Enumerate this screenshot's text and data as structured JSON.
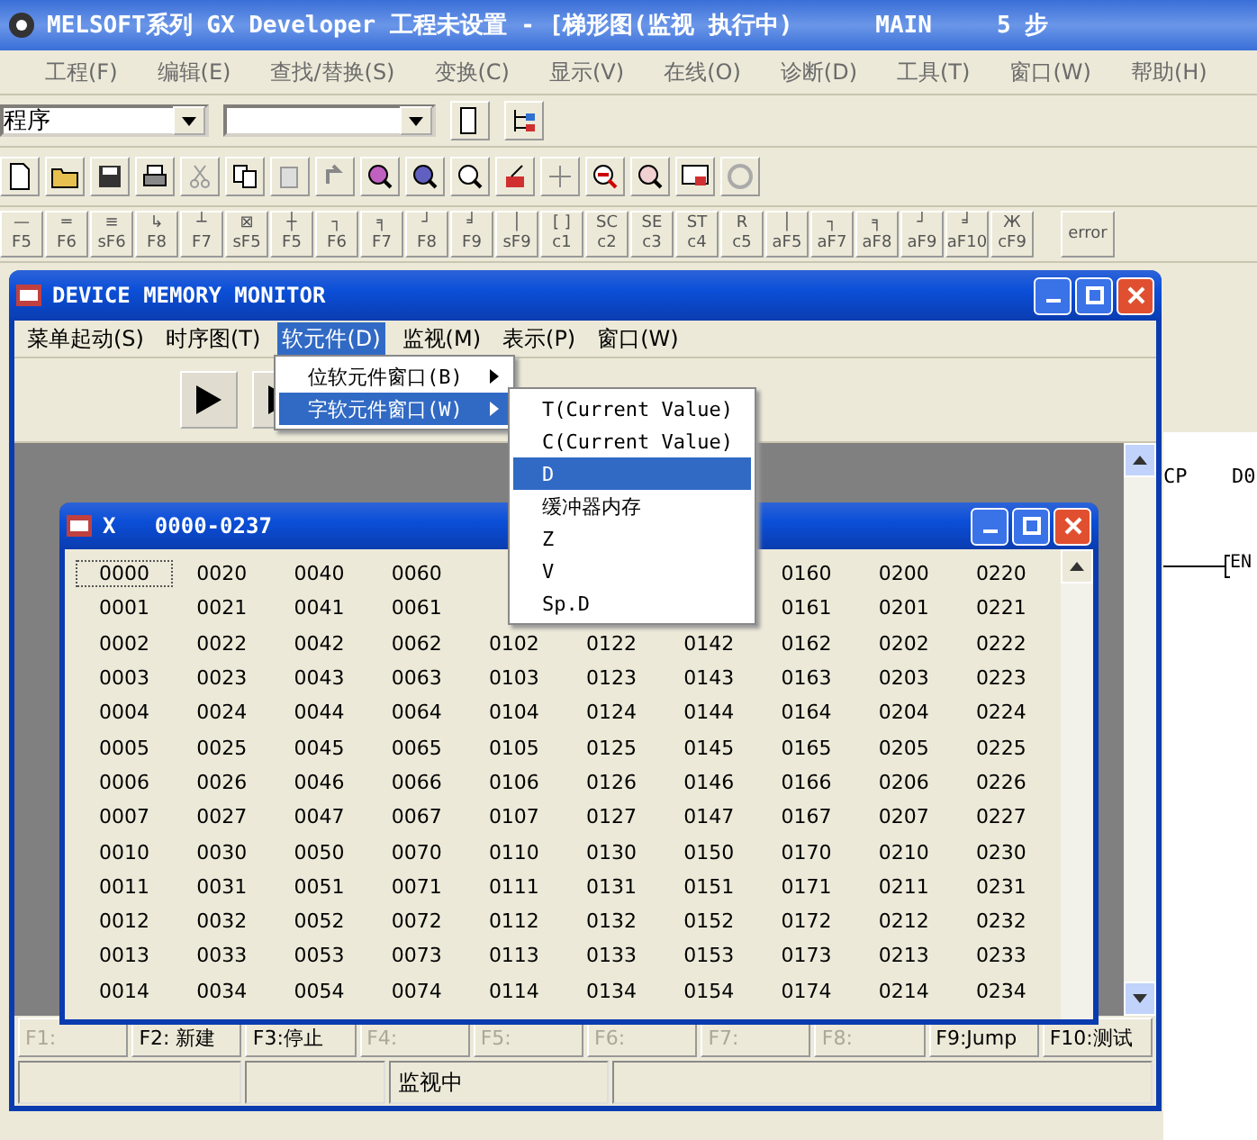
{
  "window": {
    "title": "MELSOFT系列 GX Developer 工程未设置 - [梯形图(监视 执行中)",
    "program": "MAIN",
    "steps": "5 步"
  },
  "menu": [
    "工程(F)",
    "编辑(E)",
    "查找/替换(S)",
    "变换(C)",
    "显示(V)",
    "在线(O)",
    "诊断(D)",
    "工具(T)",
    "窗口(W)",
    "帮助(H)"
  ],
  "program_combo": {
    "value": "程序"
  },
  "function_keys": [
    {
      "symbol": "—",
      "key": "F5"
    },
    {
      "symbol": "═",
      "key": "F6"
    },
    {
      "symbol": "≡",
      "key": "sF6"
    },
    {
      "symbol": "↳",
      "key": "F8"
    },
    {
      "symbol": "┴",
      "key": "F7"
    },
    {
      "symbol": "⊠",
      "key": "sF5"
    },
    {
      "symbol": "┼",
      "key": "F5"
    },
    {
      "symbol": "┐",
      "key": "F6"
    },
    {
      "symbol": "╕",
      "key": "F7"
    },
    {
      "symbol": "┘",
      "key": "F8"
    },
    {
      "symbol": "╛",
      "key": "F9"
    },
    {
      "symbol": "│",
      "key": "sF9"
    },
    {
      "symbol": "[ ]",
      "key": "c1"
    },
    {
      "symbol": "SC",
      "key": "c2"
    },
    {
      "symbol": "SE",
      "key": "c3"
    },
    {
      "symbol": "ST",
      "key": "c4"
    },
    {
      "symbol": "R",
      "key": "c5"
    },
    {
      "symbol": "│",
      "key": "aF5"
    },
    {
      "symbol": "┐",
      "key": "aF7"
    },
    {
      "symbol": "╕",
      "key": "aF8"
    },
    {
      "symbol": "┘",
      "key": "aF9"
    },
    {
      "symbol": "╛",
      "key": "aF10"
    },
    {
      "symbol": "Ж",
      "key": "cF9"
    }
  ],
  "error_label": "error",
  "ladder": {
    "labels": [
      "CP",
      "D0"
    ],
    "contact": "EN"
  },
  "monitor": {
    "title": "DEVICE MEMORY MONITOR",
    "menu": [
      {
        "label": "菜单起动(S)",
        "selected": false
      },
      {
        "label": "时序图(T)",
        "selected": false
      },
      {
        "label": "软元件(D)",
        "selected": true
      },
      {
        "label": "监视(M)",
        "selected": false
      },
      {
        "label": "表示(P)",
        "selected": false
      },
      {
        "label": "窗口(W)",
        "selected": false
      }
    ],
    "dropdown": [
      {
        "label": "位软元件窗口(B)",
        "selected": false
      },
      {
        "label": "字软元件窗口(W)",
        "selected": true
      }
    ],
    "submenu": [
      {
        "label": "T(Current Value)",
        "selected": false
      },
      {
        "label": "C(Current Value)",
        "selected": false
      },
      {
        "label": "D",
        "selected": true
      },
      {
        "label": "缓冲器内存",
        "selected": false
      },
      {
        "label": "Z",
        "selected": false
      },
      {
        "label": "V",
        "selected": false
      },
      {
        "label": "Sp.D",
        "selected": false
      }
    ],
    "device_window": {
      "title": "X   0000-0237",
      "rows": [
        [
          "0000",
          "0020",
          "0040",
          "0060",
          null,
          null,
          null,
          "0160",
          "0200",
          "0220"
        ],
        [
          "0001",
          "0021",
          "0041",
          "0061",
          null,
          null,
          null,
          "0161",
          "0201",
          "0221"
        ],
        [
          "0002",
          "0022",
          "0042",
          "0062",
          "0102",
          "0122",
          "0142",
          "0162",
          "0202",
          "0222"
        ],
        [
          "0003",
          "0023",
          "0043",
          "0063",
          "0103",
          "0123",
          "0143",
          "0163",
          "0203",
          "0223"
        ],
        [
          "0004",
          "0024",
          "0044",
          "0064",
          "0104",
          "0124",
          "0144",
          "0164",
          "0204",
          "0224"
        ],
        [
          "0005",
          "0025",
          "0045",
          "0065",
          "0105",
          "0125",
          "0145",
          "0165",
          "0205",
          "0225"
        ],
        [
          "0006",
          "0026",
          "0046",
          "0066",
          "0106",
          "0126",
          "0146",
          "0166",
          "0206",
          "0226"
        ],
        [
          "0007",
          "0027",
          "0047",
          "0067",
          "0107",
          "0127",
          "0147",
          "0167",
          "0207",
          "0227"
        ],
        [
          "0010",
          "0030",
          "0050",
          "0070",
          "0110",
          "0130",
          "0150",
          "0170",
          "0210",
          "0230"
        ],
        [
          "0011",
          "0031",
          "0051",
          "0071",
          "0111",
          "0131",
          "0151",
          "0171",
          "0211",
          "0231"
        ],
        [
          "0012",
          "0032",
          "0052",
          "0072",
          "0112",
          "0132",
          "0152",
          "0172",
          "0212",
          "0232"
        ],
        [
          "0013",
          "0033",
          "0053",
          "0073",
          "0113",
          "0133",
          "0153",
          "0173",
          "0213",
          "0233"
        ],
        [
          "0014",
          "0034",
          "0054",
          "0074",
          "0114",
          "0134",
          "0154",
          "0174",
          "0214",
          "0234"
        ]
      ]
    },
    "fkeys": [
      {
        "label": "F1:",
        "disabled": true
      },
      {
        "label": "F2: 新建",
        "disabled": false
      },
      {
        "label": "F3:停止",
        "disabled": false
      },
      {
        "label": "F4:",
        "disabled": true
      },
      {
        "label": "F5:",
        "disabled": true
      },
      {
        "label": "F6:",
        "disabled": true
      },
      {
        "label": "F7:",
        "disabled": true
      },
      {
        "label": "F8:",
        "disabled": true
      },
      {
        "label": "F9:Jump",
        "disabled": false
      },
      {
        "label": "F10:测试",
        "disabled": false
      }
    ],
    "status": "监视中"
  }
}
